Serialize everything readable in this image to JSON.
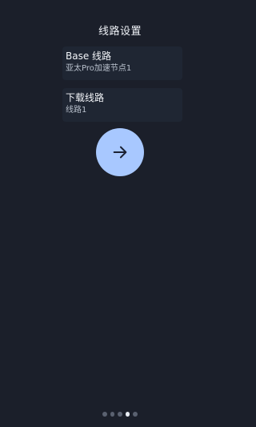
{
  "header": {
    "title": "线路设置"
  },
  "settings": {
    "items": [
      {
        "title": "Base 线路",
        "value": "亚太Pro加速节点1"
      },
      {
        "title": "下载线路",
        "value": "线路1"
      }
    ]
  },
  "navigation": {
    "next_icon": "arrow-right-icon",
    "page_count": 5,
    "active_page": 4
  },
  "colors": {
    "background": "#1b1f2a",
    "card": "#1f2633",
    "accent": "#a8c8ff",
    "dot_inactive": "#5a6170",
    "dot_active": "#e8ecf3"
  }
}
